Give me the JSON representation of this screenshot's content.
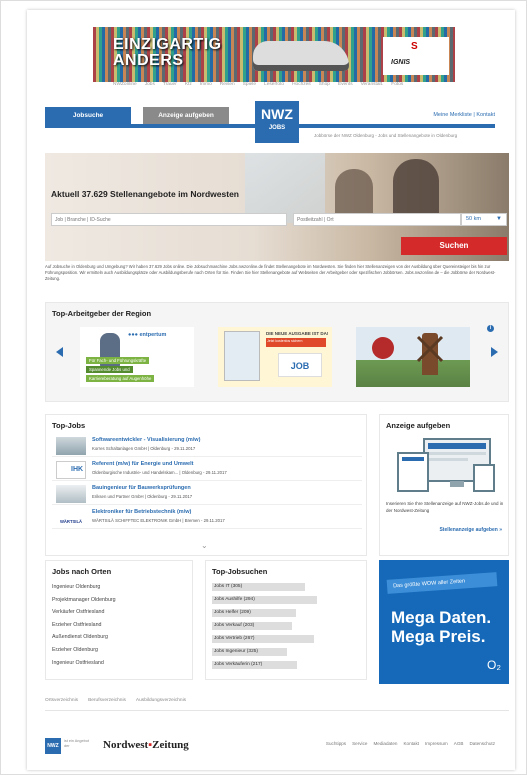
{
  "banner": {
    "line1": "EINZIGARTIG",
    "line2": "ANDERS",
    "brand_mark": "S",
    "brand_name": "IGNIS"
  },
  "topnav": [
    "NWZonline",
    "Jobs",
    "Trauer",
    "Kfz",
    "Immo",
    "Reisen",
    "Spiele",
    "Leserfoto",
    "Hochzeit",
    "Shop",
    "Events",
    "Veranstalt.",
    "Fotos"
  ],
  "header": {
    "jobsuche_label": "Jobsuche",
    "anzeige_label": "Anzeige aufgeben",
    "logo_top": "NWZ",
    "logo_bottom": "JOBS",
    "merkliste": "Meine Merkliste",
    "separator": "|",
    "kontakt": "Kontakt",
    "tagline": "Jobbörse der NWZ Oldenburg - Jobs und Stellenangebote in Oldenburg"
  },
  "hero": {
    "title": "Aktuell 37.629 Stellenangebote im Nordwesten",
    "what_placeholder": "Job | Branche | ID-Suche",
    "where_placeholder": "Postleitzahl | Ort",
    "radius": "50 km",
    "search_label": "Suchen"
  },
  "intro": "Auf Jobsuche in Oldenburg und Umgebung? Wir haben 37.629 Jobs online. Die Jobsuchmaschine Jobs.nwzonline.de findet Stellenangebote im Nordwesten. Sie finden hier Stellenanzeigen von der Ausbildung über Quereinsteiger bis hin zur Führungsposition. Wir ermitteln auch Ausbildungsplätze oder Ausbildungsberufe nach Orten für Sie. Finden Sie hier Stellenangebote auf Webseiten der Arbeitgeber oder spezifischen Jobbörsen. Jobs.nwzonline.de – die Jobbörse der Nordwest-Zeitung.",
  "employers": {
    "title": "Top-Arbeitgeber der Region",
    "emp1_logo": "●●● entpertum",
    "emp1_tags": [
      "Für Fach- und Führungskräfte",
      "Spannende Jobs und",
      "Karriereberatung auf Augenhöhe"
    ],
    "emp2_head": "DIE NEUE AUSGABE IST DA!",
    "emp2_red": "Jetzt kostenlos sichern",
    "emp2_badge": "JOB",
    "info": "i"
  },
  "topjobs": {
    "title": "Top-Jobs",
    "rows": [
      {
        "logo": "",
        "title": "Softwareentwickler - Visualisierung (m/w)",
        "meta": "Korres Schaltanlagen GmbH | Oldenburg - 29.11.2017"
      },
      {
        "logo": "IHK",
        "title": "Referent (m/w) für Energie und Umwelt",
        "meta": "Oldenburgische Industrie- und Handelskam... | Oldenburg - 29.11.2017"
      },
      {
        "logo": "",
        "title": "Bauingenieur für Bauwerksprüfungen",
        "meta": "Eriksen und Partner GmbH | Oldenburg - 29.11.2017"
      },
      {
        "logo": "WÄRTSILÄ",
        "title": "Elektroniker für Betriebstechnik (m/w)",
        "meta": "WÄRTSILÄ SCHIFFTEC ELEKTRONIK GmbH | Bremen - 29.11.2017"
      }
    ],
    "more": "⌄"
  },
  "anzeige": {
    "title": "Anzeige aufgeben",
    "text": "Inserieren Sie Ihre Stellenanzeige auf NWZ-Jobs.de und in der Nordwest-Zeitung",
    "link": "Stellenanzeige aufgeben »"
  },
  "orten": {
    "title": "Jobs nach Orten",
    "items": [
      "Ingenieur Oldenburg",
      "Projektmanager Oldenburg",
      "Verkäufer Ostfriesland",
      "Erzieher Ostfriesland",
      "Außendienst Oldenburg",
      "Erzieher Oldenburg",
      "Ingenieur Ostfriesland"
    ]
  },
  "topsuch": {
    "title": "Top-Jobsuchen",
    "items": [
      {
        "label": "Jobs IT (305)",
        "share": 0.62
      },
      {
        "label": "Jobs Aushilfe (294)",
        "share": 0.7
      },
      {
        "label": "Jobs Helfer (209)",
        "share": 0.56
      },
      {
        "label": "Jobs Verkauf (203)",
        "share": 0.53
      },
      {
        "label": "Jobs Vertrieb (267)",
        "share": 0.68
      },
      {
        "label": "Jobs Ingenieur (325)",
        "share": 0.5
      },
      {
        "label": "Jobs Verkäuferin (217)",
        "share": 0.57
      }
    ]
  },
  "ad": {
    "strip": "Das größte WOW aller Zeiten",
    "line1": "Mega Daten.",
    "line2": "Mega Preis.",
    "brand": "O₂"
  },
  "footer": {
    "links": [
      "Ortsverzeichnis",
      "Berufsverzeichnis",
      "Ausbildungsverzeichnis"
    ],
    "logo": "NWZ",
    "logo_sub": "ist ein Angebot der",
    "paper_a": "Nordwest",
    "paper_b": "Zeitung",
    "nav": [
      "Suchtipps",
      "Service",
      "Mediadaten",
      "Kontakt",
      "Impressum",
      "AGB",
      "Datenschutz"
    ]
  },
  "colors": {
    "brand_blue": "#2b6cb0",
    "search_red": "#d42a2a",
    "ad_blue": "#1569b8"
  }
}
